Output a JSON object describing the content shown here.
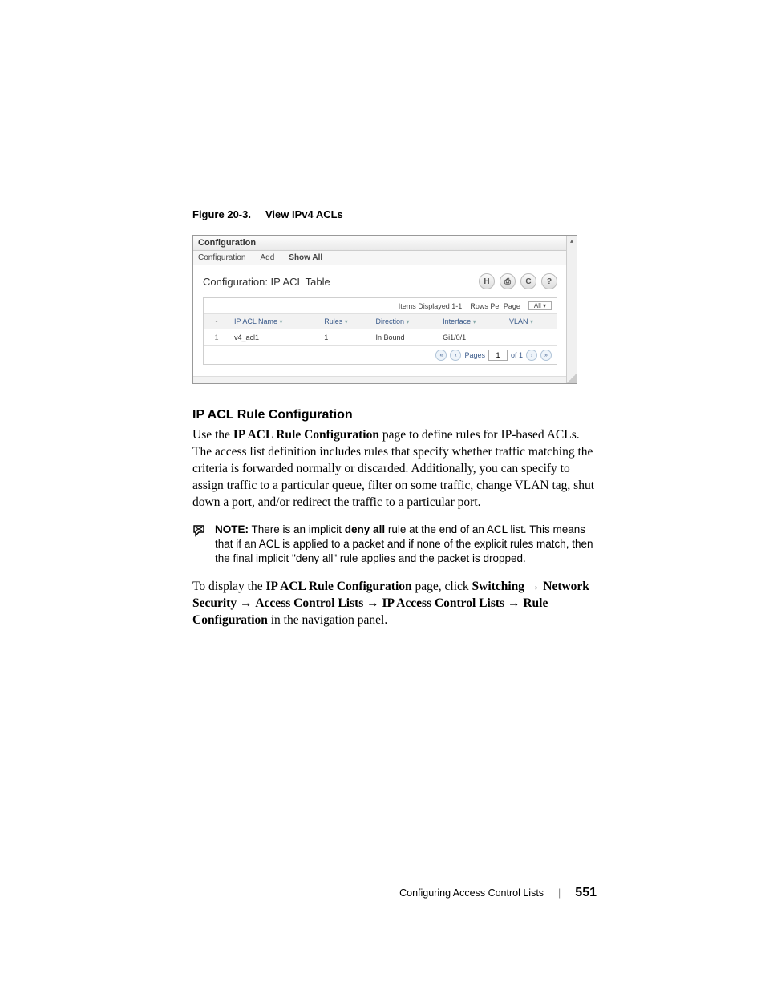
{
  "figure": {
    "label": "Figure 20-3.",
    "title": "View IPv4 ACLs"
  },
  "sshot": {
    "tab1": "Configuration",
    "tabs2": {
      "a": "Configuration",
      "b": "Add",
      "c": "Show All"
    },
    "panel_title": "Configuration: IP ACL Table",
    "icons": {
      "save": "H",
      "print": "⎙",
      "refresh": "C",
      "help": "?"
    },
    "toprow": {
      "items": "Items Displayed 1-1",
      "rows_label": "Rows Per Page",
      "rows_val": "All"
    },
    "headers": {
      "idx": "-",
      "name": "IP ACL Name",
      "rules": "Rules",
      "dir": "Direction",
      "iface": "Interface",
      "vlan": "VLAN"
    },
    "row": {
      "idx": "1",
      "name": "v4_acl1",
      "rules": "1",
      "dir": "In Bound",
      "iface": "Gi1/0/1",
      "vlan": ""
    },
    "pager": {
      "pages_label": "Pages",
      "page": "1",
      "of": "of 1"
    }
  },
  "section_title": "IP ACL Rule Configuration",
  "para1_a": "Use the ",
  "para1_b": "IP ACL Rule Configuration",
  "para1_c": " page to define rules for IP-based ACLs. The access list definition includes rules that specify whether traffic matching the criteria is forwarded normally or discarded. Additionally, you can specify to assign traffic to a particular queue, filter on some traffic, change VLAN tag, shut down a port, and/or redirect the traffic to a particular port.",
  "note": {
    "label": "NOTE:",
    "a": " There is an implicit ",
    "b": "deny all",
    "c": " rule at the end of an ACL list. This means that if an ACL is applied to a packet and if none of the explicit rules match, then the final implicit \"deny all\" rule applies and the packet is dropped."
  },
  "para2": {
    "a": "To display the ",
    "b": "IP ACL Rule Configuration",
    "c": " page, click ",
    "n1": "Switching",
    "n2": "Network Security",
    "n3": "Access Control Lists",
    "n4": "IP Access Control Lists",
    "n5": "Rule Configuration",
    "d": " in the navigation panel."
  },
  "footer": {
    "chapter": "Configuring Access Control Lists",
    "page": "551"
  }
}
